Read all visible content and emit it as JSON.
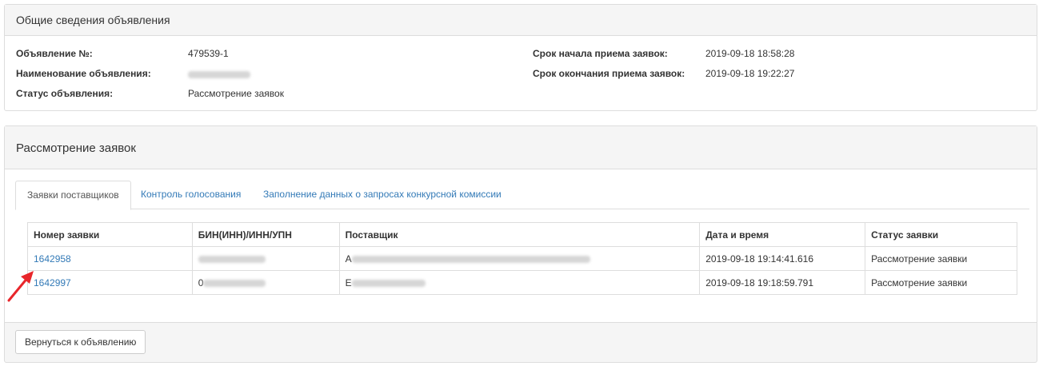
{
  "general": {
    "title": "Общие сведения объявления",
    "fields_left": [
      {
        "label": "Объявление №:",
        "value": "479539-1"
      },
      {
        "label": "Наименование объявления:",
        "value": ""
      },
      {
        "label": "Статус объявления:",
        "value": "Рассмотрение заявок"
      }
    ],
    "fields_right": [
      {
        "label": "Срок начала приема заявок:",
        "value": "2019-09-18 18:58:28"
      },
      {
        "label": "Срок окончания приема заявок:",
        "value": "2019-09-18 19:22:27"
      }
    ]
  },
  "review": {
    "title": "Рассмотрение заявок",
    "tabs": [
      {
        "label": "Заявки поставщиков",
        "active": true
      },
      {
        "label": "Контроль голосования",
        "active": false
      },
      {
        "label": "Заполнение данных о запросах конкурсной комиссии",
        "active": false
      }
    ],
    "table": {
      "headers": [
        "Номер заявки",
        "БИН(ИНН)/ИНН/УПН",
        "Поставщик",
        "Дата и время",
        "Статус заявки"
      ],
      "rows": [
        {
          "number": "1642958",
          "bin": "",
          "supplier": "А",
          "datetime": "2019-09-18 19:14:41.616",
          "status": "Рассмотрение заявки"
        },
        {
          "number": "1642997",
          "bin": "0",
          "supplier": "Е",
          "datetime": "2019-09-18 19:18:59.791",
          "status": "Рассмотрение заявки"
        }
      ]
    },
    "back_button": "Вернуться к объявлению"
  },
  "colors": {
    "link": "#337ab7",
    "annotation_arrow": "#e8262b",
    "panel_header": "#f5f5f5",
    "border": "#dddddd"
  }
}
